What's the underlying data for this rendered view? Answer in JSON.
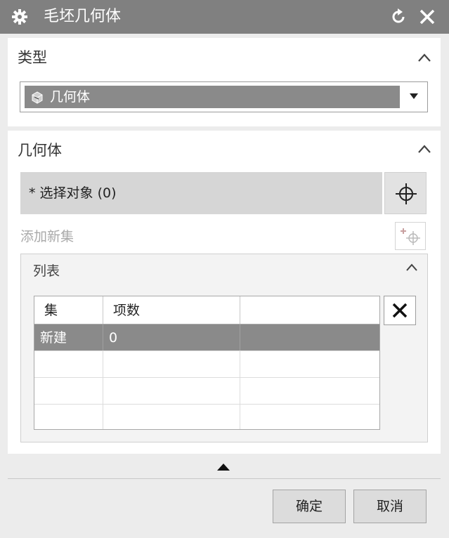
{
  "window": {
    "title": "毛坯几何体",
    "icons": {
      "settings": "gear-icon",
      "reset": "reset-icon",
      "close": "close-icon"
    }
  },
  "type_section": {
    "title": "类型",
    "selected_value": "几何体",
    "value_icon": "geometry-body-icon"
  },
  "geometry_section": {
    "title": "几何体",
    "select_object_label": "* 选择对象 (0)",
    "add_new_set_label": "添加新集",
    "list": {
      "title": "列表",
      "columns": [
        "集",
        "项数",
        ""
      ],
      "rows": [
        {
          "set": "新建",
          "count": "0",
          "extra": "",
          "selected": true
        },
        {
          "set": "",
          "count": "",
          "extra": ""
        },
        {
          "set": "",
          "count": "",
          "extra": ""
        },
        {
          "set": "",
          "count": "",
          "extra": ""
        }
      ]
    }
  },
  "footer": {
    "ok_label": "确定",
    "cancel_label": "取消"
  },
  "colors": {
    "titlebar": "#808080",
    "selection": "#8a8a8a",
    "select_object_bg": "#d6d6d6"
  }
}
